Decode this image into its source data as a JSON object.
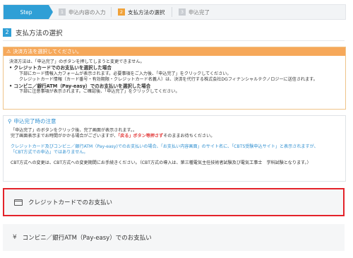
{
  "steps": {
    "s1": {
      "label": "Step"
    },
    "s2": {
      "num": "1",
      "label": "申込内容の入力"
    },
    "s3": {
      "num": "2",
      "label": "支払方法の選択"
    },
    "s4": {
      "num": "3",
      "label": "申込完了"
    }
  },
  "section": {
    "num": "2",
    "title": "支払方法の選択"
  },
  "warning": {
    "header": "決済方法を選択してください。",
    "line1": "決済方法は、「申込完了」のボタンを押してしまうと変更できません。",
    "card_title": "クレジットカードでのお支払いを選択した場合",
    "card_line1": "下部にカード情報入力フォームが表示されます。必要事項をご入力後、「申込完了」をクリックしてください。",
    "card_line2": "クレジットカード情報（カード番号・有効期限・クレジットカード名義人）は、決済を代行する株式会社DGフィナンシャルテクノロジーに送信されます。",
    "conv_title": "コンビニ／銀行ATM（Pay-easy）でのお支払いを選択した場合",
    "conv_line1": "下部に注意事項が表示されます。ご確認後、「申込完了」をクリックしてください。"
  },
  "notes": {
    "header": "申込完了時の注意",
    "line1": "「申込完了」のボタンをクリック後、完了画面が表示されます。。",
    "line2_a": "完了画面表示までお時間がかかる場合がございますが、",
    "line2_red": "「戻る」ボタン等押さず",
    "line2_b": "そのままお待ちください。",
    "line3": "クレジットカード及びコンビニ／銀行ATM（Pay-easy)でのお支払いの場合、「お支払い内容画面」のサイト名に、「CBTS受験申込サイト」と表示されますが、",
    "line4": "「CBT方式での申込」ではありません。",
    "line5": "CBT方式への変更は、CBT方式への変更期間にお手続きください。（CBT方式の導入は、第三種電気主任技術者試験及び電気工事士　学科試験となります。）"
  },
  "payments": {
    "card": {
      "label": "クレジットカードでのお支払い",
      "icon": "credit-card-icon"
    },
    "conv": {
      "label": "コンビニ／銀行ATM（Pay-easy）でのお支払い",
      "icon": "yen-icon",
      "symbol": "¥"
    }
  },
  "colors": {
    "accent": "#2f9fd6",
    "warning": "#f6a85a",
    "highlight": "#e3232a",
    "link": "#2f8fd0"
  }
}
